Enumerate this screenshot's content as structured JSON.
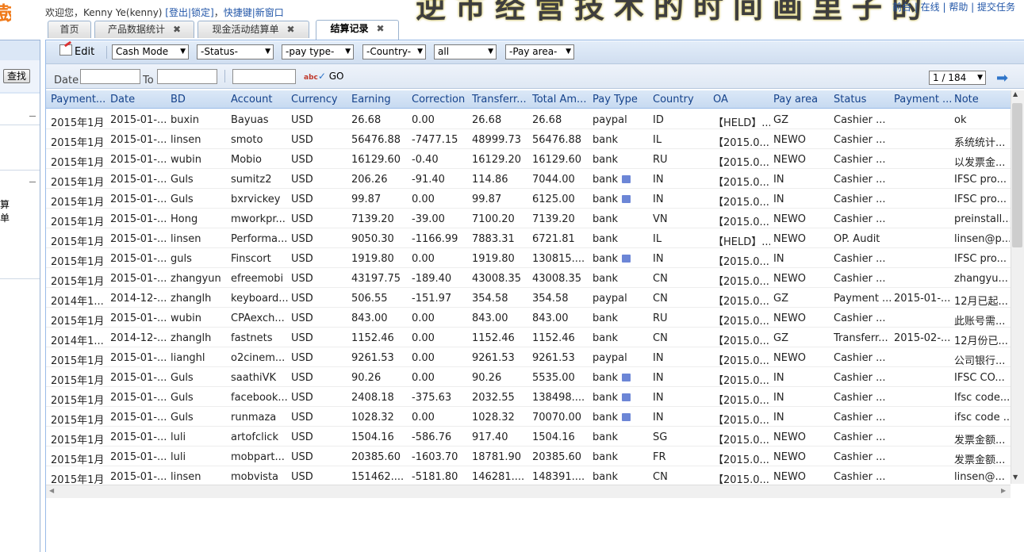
{
  "left": {
    "logo_fragment": "鼓",
    "search_button": "查找",
    "menu_fragment": "算单"
  },
  "header": {
    "welcome_prefix": "欢迎您，Kenny Ye(kenny) ",
    "logout_lock": "[登出|锁定]",
    "welcome_sep": "，",
    "shortcut_links": "快捷键|新窗口",
    "banner": "逆市经营技术的时间画里子的",
    "top_right_links": "前台 | 在线 | 帮助 | 提交任务"
  },
  "tabs": [
    {
      "label": "首页",
      "closable": false,
      "active": false
    },
    {
      "label": "产品数据统计",
      "closable": true,
      "active": false
    },
    {
      "label": "现金活动结算单",
      "closable": true,
      "active": false
    },
    {
      "label": "结算记录",
      "closable": true,
      "active": true
    }
  ],
  "tab_close_glyph": "✖",
  "toolbar": {
    "edit_label": "Edit",
    "mode_select": "Cash Mode",
    "status_select": "-Status-",
    "paytype_select": "-pay type-",
    "country_select": "-Country-",
    "all_select": "all",
    "payarea_select": "-Pay area-",
    "date_label": "Date",
    "to_label": "To",
    "go_label": "GO",
    "go_icon": "abc",
    "page_select": "1 / 184"
  },
  "columns": [
    "Payment...",
    "Date",
    "BD",
    "Account",
    "Currency",
    "Earning",
    "Correction",
    "Transferr...",
    "Total Am...",
    "Pay Type",
    "Country",
    "OA",
    "Pay area",
    "Status",
    "Payment ...",
    "Note"
  ],
  "rows": [
    {
      "payment": "2015年1月",
      "date": "2015-01-...",
      "bd": "buxin",
      "account": "Bayuas",
      "currency": "USD",
      "earning": "26.68",
      "correction": "0.00",
      "transferred": "26.68",
      "total": "26.68",
      "paytype": "paypal",
      "flag": false,
      "country": "ID",
      "oa": "【HELD】...",
      "payarea": "GZ",
      "status": "Cashier ...",
      "paydate": "",
      "note": "ok"
    },
    {
      "payment": "2015年1月",
      "date": "2015-01-...",
      "bd": "linsen",
      "account": "smoto",
      "currency": "USD",
      "earning": "56476.88",
      "correction": "-7477.15",
      "transferred": "48999.73",
      "total": "56476.88",
      "paytype": "bank",
      "flag": false,
      "country": "IL",
      "oa": "【2015.0...",
      "payarea": "NEWO",
      "status": "Cashier ...",
      "paydate": "",
      "note": "系统统计..."
    },
    {
      "payment": "2015年1月",
      "date": "2015-01-...",
      "bd": "wubin",
      "account": "Mobio",
      "currency": "USD",
      "earning": "16129.60",
      "correction": "-0.40",
      "transferred": "16129.20",
      "total": "16129.60",
      "paytype": "bank",
      "flag": false,
      "country": "RU",
      "oa": "【2015.0...",
      "payarea": "NEWO",
      "status": "Cashier ...",
      "paydate": "",
      "note": "以发票金..."
    },
    {
      "payment": "2015年1月",
      "date": "2015-01-...",
      "bd": "Guls",
      "account": "sumitz2",
      "currency": "USD",
      "earning": "206.26",
      "correction": "-91.40",
      "transferred": "114.86",
      "total": "7044.00",
      "paytype": "bank",
      "flag": true,
      "country": "IN",
      "oa": "【2015.0...",
      "payarea": "IN",
      "status": "Cashier ...",
      "paydate": "",
      "note": "IFSC pro..."
    },
    {
      "payment": "2015年1月",
      "date": "2015-01-...",
      "bd": "Guls",
      "account": "bxrvickey",
      "currency": "USD",
      "earning": "99.87",
      "correction": "0.00",
      "transferred": "99.87",
      "total": "6125.00",
      "paytype": "bank",
      "flag": true,
      "country": "IN",
      "oa": "【2015.0...",
      "payarea": "IN",
      "status": "Cashier ...",
      "paydate": "",
      "note": "IFSC pro..."
    },
    {
      "payment": "2015年1月",
      "date": "2015-01-...",
      "bd": "Hong",
      "account": "mworkpr...",
      "currency": "USD",
      "earning": "7139.20",
      "correction": "-39.00",
      "transferred": "7100.20",
      "total": "7139.20",
      "paytype": "bank",
      "flag": false,
      "country": "VN",
      "oa": "【2015.0...",
      "payarea": "NEWO",
      "status": "Cashier ...",
      "paydate": "",
      "note": "preinstall..."
    },
    {
      "payment": "2015年1月",
      "date": "2015-01-...",
      "bd": "linsen",
      "account": "Performa...",
      "currency": "USD",
      "earning": "9050.30",
      "correction": "-1166.99",
      "transferred": "7883.31",
      "total": "6721.81",
      "paytype": "bank",
      "flag": false,
      "country": "IL",
      "oa": "【HELD】...",
      "payarea": "NEWO",
      "status": "OP. Audit",
      "paydate": "",
      "note": "linsen@p..."
    },
    {
      "payment": "2015年1月",
      "date": "2015-01-...",
      "bd": "guls",
      "account": "Finscort",
      "currency": "USD",
      "earning": "1919.80",
      "correction": "0.00",
      "transferred": "1919.80",
      "total": "130815....",
      "paytype": "bank",
      "flag": true,
      "country": "IN",
      "oa": "【2015.0...",
      "payarea": "IN",
      "status": "Cashier ...",
      "paydate": "",
      "note": "IFSC pro..."
    },
    {
      "payment": "2015年1月",
      "date": "2015-01-...",
      "bd": "zhangyun",
      "account": "efreemobi",
      "currency": "USD",
      "earning": "43197.75",
      "correction": "-189.40",
      "transferred": "43008.35",
      "total": "43008.35",
      "paytype": "bank",
      "flag": false,
      "country": "CN",
      "oa": "【2015.0...",
      "payarea": "NEWO",
      "status": "Cashier ...",
      "paydate": "",
      "note": "zhangyu..."
    },
    {
      "payment": "2014年1...",
      "date": "2014-12-...",
      "bd": "zhanglh",
      "account": "keyboard...",
      "currency": "USD",
      "earning": "506.55",
      "correction": "-151.97",
      "transferred": "354.58",
      "total": "354.58",
      "paytype": "paypal",
      "flag": false,
      "country": "CN",
      "oa": "【2015.0...",
      "payarea": "GZ",
      "status": "Payment ...",
      "paydate": "2015-01-...",
      "note": "12月已起..."
    },
    {
      "payment": "2015年1月",
      "date": "2015-01-...",
      "bd": "wubin",
      "account": "CPAexch...",
      "currency": "USD",
      "earning": "843.00",
      "correction": "0.00",
      "transferred": "843.00",
      "total": "843.00",
      "paytype": "bank",
      "flag": false,
      "country": "RU",
      "oa": "【2015.0...",
      "payarea": "NEWO",
      "status": "Cashier ...",
      "paydate": "",
      "note": "此账号需..."
    },
    {
      "payment": "2014年1...",
      "date": "2014-12-...",
      "bd": "zhanglh",
      "account": "fastnets",
      "currency": "USD",
      "earning": "1152.46",
      "correction": "0.00",
      "transferred": "1152.46",
      "total": "1152.46",
      "paytype": "bank",
      "flag": false,
      "country": "CN",
      "oa": "【2015.0...",
      "payarea": "GZ",
      "status": "Transferr...",
      "paydate": "2015-02-...",
      "note": "12月份已..."
    },
    {
      "payment": "2015年1月",
      "date": "2015-01-...",
      "bd": "lianghl",
      "account": "o2cinem...",
      "currency": "USD",
      "earning": "9261.53",
      "correction": "0.00",
      "transferred": "9261.53",
      "total": "9261.53",
      "paytype": "paypal",
      "flag": false,
      "country": "IN",
      "oa": "【2015.0...",
      "payarea": "NEWO",
      "status": "Cashier ...",
      "paydate": "",
      "note": "公司银行..."
    },
    {
      "payment": "2015年1月",
      "date": "2015-01-...",
      "bd": "Guls",
      "account": "saathiVK",
      "currency": "USD",
      "earning": "90.26",
      "correction": "0.00",
      "transferred": "90.26",
      "total": "5535.00",
      "paytype": "bank",
      "flag": true,
      "country": "IN",
      "oa": "【2015.0...",
      "payarea": "IN",
      "status": "Cashier ...",
      "paydate": "",
      "note": "IFSC CO..."
    },
    {
      "payment": "2015年1月",
      "date": "2015-01-...",
      "bd": "Guls",
      "account": "facebook...",
      "currency": "USD",
      "earning": "2408.18",
      "correction": "-375.63",
      "transferred": "2032.55",
      "total": "138498....",
      "paytype": "bank",
      "flag": true,
      "country": "IN",
      "oa": "【2015.0...",
      "payarea": "IN",
      "status": "Cashier ...",
      "paydate": "",
      "note": "Ifsc code..."
    },
    {
      "payment": "2015年1月",
      "date": "2015-01-...",
      "bd": "Guls",
      "account": "runmaza",
      "currency": "USD",
      "earning": "1028.32",
      "correction": "0.00",
      "transferred": "1028.32",
      "total": "70070.00",
      "paytype": "bank",
      "flag": true,
      "country": "IN",
      "oa": "【2015.0...",
      "payarea": "IN",
      "status": "Cashier ...",
      "paydate": "",
      "note": "ifsc code ..."
    },
    {
      "payment": "2015年1月",
      "date": "2015-01-...",
      "bd": "luli",
      "account": "artofclick",
      "currency": "USD",
      "earning": "1504.16",
      "correction": "-586.76",
      "transferred": "917.40",
      "total": "1504.16",
      "paytype": "bank",
      "flag": false,
      "country": "SG",
      "oa": "【2015.0...",
      "payarea": "NEWO",
      "status": "Cashier ...",
      "paydate": "",
      "note": "发票金额..."
    },
    {
      "payment": "2015年1月",
      "date": "2015-01-...",
      "bd": "luli",
      "account": "mobpart...",
      "currency": "USD",
      "earning": "20385.60",
      "correction": "-1603.70",
      "transferred": "18781.90",
      "total": "20385.60",
      "paytype": "bank",
      "flag": false,
      "country": "FR",
      "oa": "【2015.0...",
      "payarea": "NEWO",
      "status": "Cashier ...",
      "paydate": "",
      "note": "发票金额..."
    },
    {
      "payment": "2015年1月",
      "date": "2015-01-...",
      "bd": "linsen",
      "account": "mobvista",
      "currency": "USD",
      "earning": "151462....",
      "correction": "-5181.80",
      "transferred": "146281....",
      "total": "148391....",
      "paytype": "bank",
      "flag": false,
      "country": "CN",
      "oa": "【2015.0...",
      "payarea": "NEWO",
      "status": "Cashier ...",
      "paydate": "",
      "note": "linsen@..."
    }
  ],
  "colors": {
    "header_text": "#15428b",
    "link": "#2256a8",
    "panel_border": "#99bbe8",
    "flag_icon": "#6c86d6"
  }
}
